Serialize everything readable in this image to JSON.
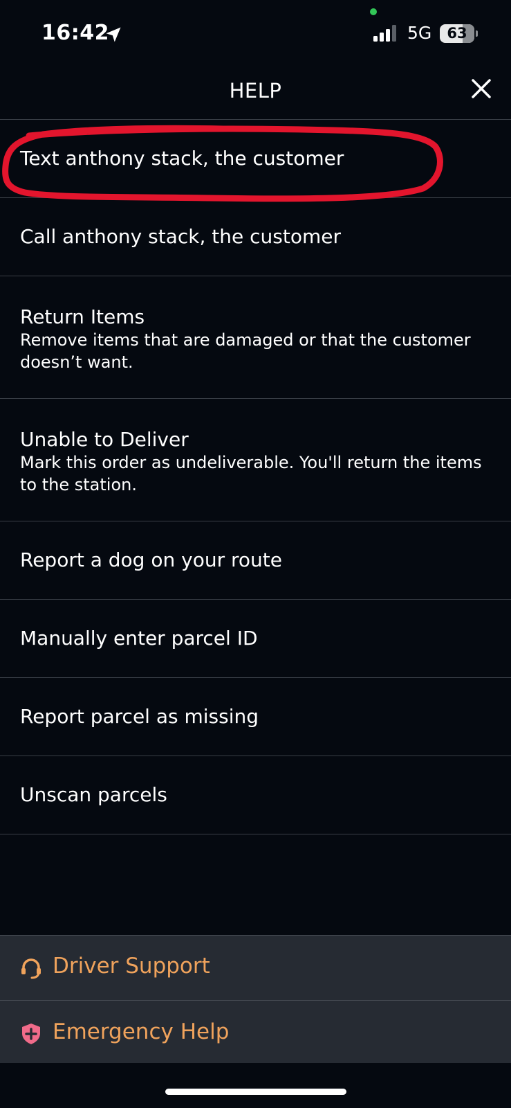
{
  "status_bar": {
    "time": "16:42",
    "network": "5G",
    "battery": "63"
  },
  "header": {
    "title": "HELP"
  },
  "menu": {
    "items": [
      {
        "label": "Text anthony stack, the customer"
      },
      {
        "label": "Call anthony stack, the customer"
      },
      {
        "label": "Return Items",
        "description": "Remove items that are damaged or that the customer doesn’t want."
      },
      {
        "label": "Unable to Deliver",
        "description": "Mark this order as undeliverable. You'll return the items to the station."
      },
      {
        "label": "Report a dog on your route"
      },
      {
        "label": "Manually enter parcel ID"
      },
      {
        "label": "Report parcel as missing"
      },
      {
        "label": "Unscan parcels"
      }
    ]
  },
  "actions": {
    "driver_support": {
      "label": "Driver Support",
      "icon": "headset-icon"
    },
    "emergency_help": {
      "label": "Emergency Help",
      "icon": "shield-plus-icon"
    }
  },
  "colors": {
    "background": "#050910",
    "accent": "#f0a35c",
    "emergency_icon": "#f06b8a",
    "annotation": "#e3152d",
    "bottom_panel": "#262b33"
  }
}
